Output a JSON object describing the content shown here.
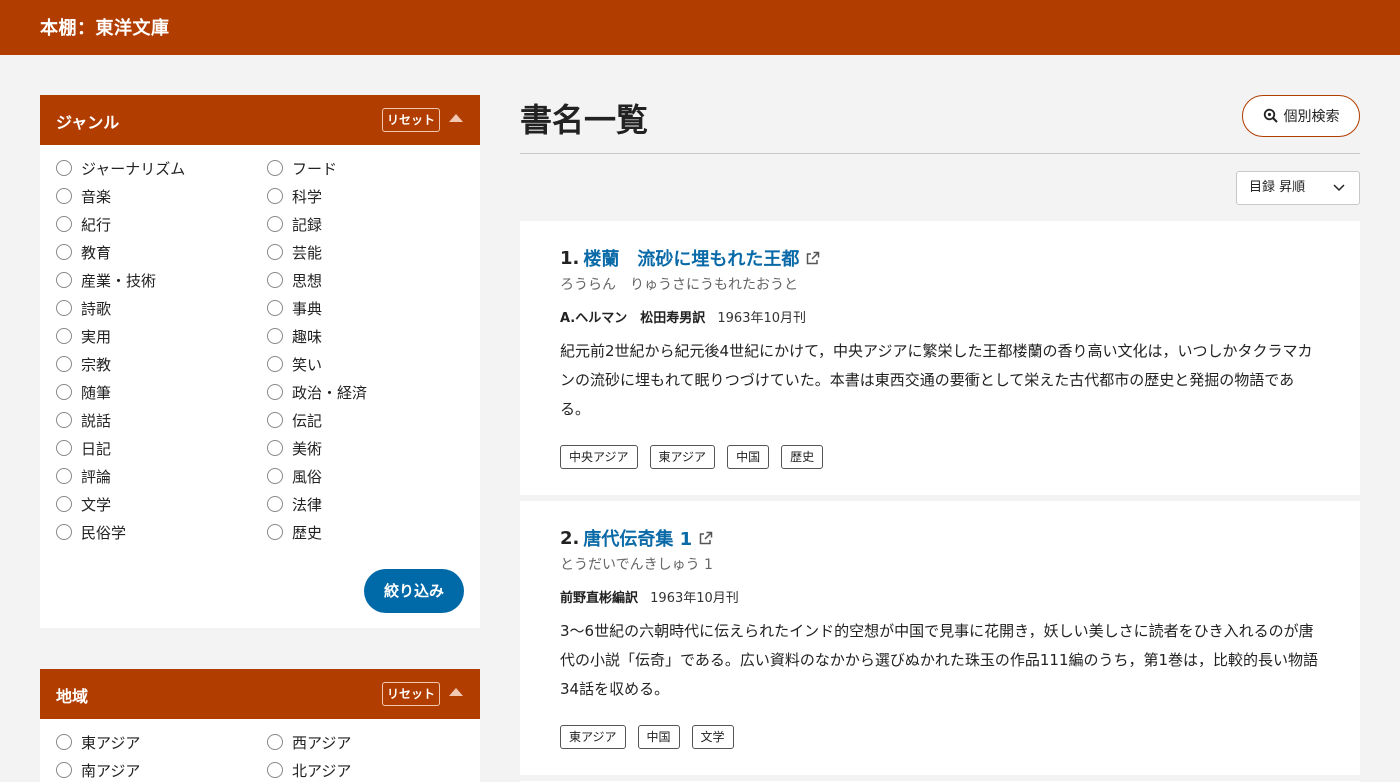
{
  "header": {
    "title": "本棚：東洋文庫"
  },
  "filters": {
    "genre": {
      "title": "ジャンル",
      "reset_label": "リセット",
      "apply_label": "絞り込み",
      "options_col1": [
        "ジャーナリズム",
        "音楽",
        "紀行",
        "教育",
        "産業・技術",
        "詩歌",
        "実用",
        "宗教",
        "随筆",
        "説話",
        "日記",
        "評論",
        "文学",
        "民俗学"
      ],
      "options_col2": [
        "フード",
        "科学",
        "記録",
        "芸能",
        "思想",
        "事典",
        "趣味",
        "笑い",
        "政治・経済",
        "伝記",
        "美術",
        "風俗",
        "法律",
        "歴史"
      ]
    },
    "region": {
      "title": "地域",
      "reset_label": "リセット",
      "options_col1": [
        "東アジア",
        "南アジア"
      ],
      "options_col2": [
        "西アジア",
        "北アジア"
      ]
    }
  },
  "main": {
    "title": "書名一覧",
    "search_label": "個別検索",
    "sort_label": "目録 昇順"
  },
  "books": [
    {
      "num": "1.",
      "title": "楼蘭　流砂に埋もれた王都",
      "kana": "ろうらん　りゅうさにうもれたおうと",
      "author": "A.ヘルマン　松田寿男訳",
      "date": "1963年10月刊",
      "desc": "紀元前2世紀から紀元後4世紀にかけて，中央アジアに繁栄した王都楼蘭の香り高い文化は，いつしかタクラマカンの流砂に埋もれて眠りつづけていた。本書は東西交通の要衝として栄えた古代都市の歴史と発掘の物語である。",
      "tags": [
        "中央アジア",
        "東アジア",
        "中国",
        "歴史"
      ]
    },
    {
      "num": "2.",
      "title": "唐代伝奇集 1",
      "kana": "とうだいでんきしゅう 1",
      "author": "前野直彬編訳",
      "date": "1963年10月刊",
      "desc": "3～6世紀の六朝時代に伝えられたインド的空想が中国で見事に花開き，妖しい美しさに読者をひき入れるのが唐代の小説「伝奇」である。広い資料のなかから選びぬかれた珠玉の作品111編のうち，第1巻は，比較的長い物語34話を収める。",
      "tags": [
        "東アジア",
        "中国",
        "文学"
      ]
    }
  ]
}
